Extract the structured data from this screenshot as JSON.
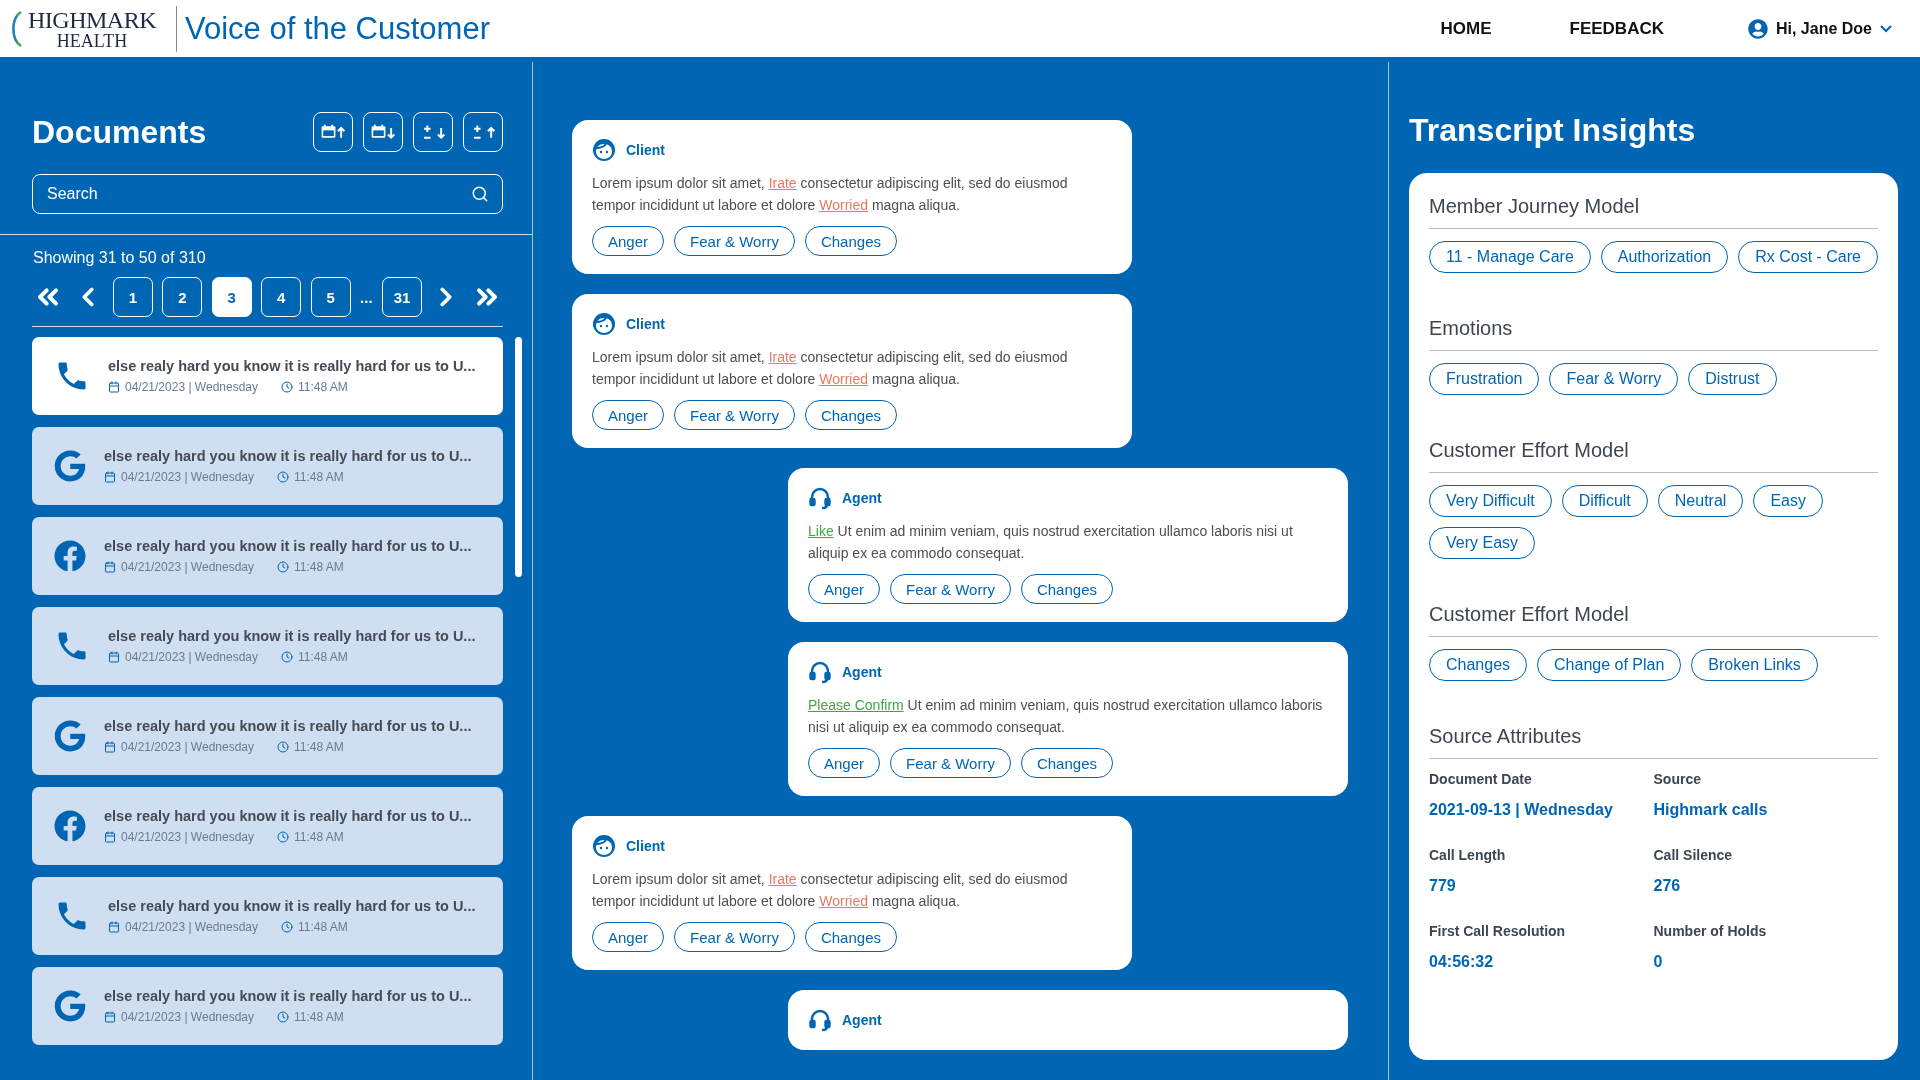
{
  "header": {
    "logo_top": "HIGHMARK",
    "logo_bottom": "HEALTH",
    "title": "Voice of the Customer",
    "nav": [
      {
        "label": "HOME"
      },
      {
        "label": "FEEDBACK"
      }
    ],
    "user": "Hi, Jane Doe"
  },
  "documents": {
    "title": "Documents",
    "sort_buttons": [
      {
        "kind": "date-up"
      },
      {
        "kind": "date-down"
      },
      {
        "kind": "num-down"
      },
      {
        "kind": "num-up"
      }
    ],
    "search": {
      "placeholder": "Search"
    },
    "showing": "Showing 31 to 50 of 310",
    "pages": [
      {
        "label": "1",
        "selected": false
      },
      {
        "label": "2",
        "selected": false
      },
      {
        "label": "3",
        "selected": true
      },
      {
        "label": "4",
        "selected": false
      },
      {
        "label": "5",
        "selected": false
      },
      {
        "label": "...",
        "kind": "gap"
      },
      {
        "label": "31",
        "selected": false
      }
    ],
    "items": [
      {
        "kind": "phone",
        "selected": true,
        "title": "else realy hard you know it is really hard for us to U...",
        "date": "04/21/2023 | Wednesday",
        "time": "11:48 AM"
      },
      {
        "kind": "google",
        "selected": false,
        "title": "else realy hard you know it is really hard for us to U...",
        "date": "04/21/2023 | Wednesday",
        "time": "11:48 AM"
      },
      {
        "kind": "facebook",
        "selected": false,
        "title": "else realy hard you know it is really hard for us to U...",
        "date": "04/21/2023 | Wednesday",
        "time": "11:48 AM"
      },
      {
        "kind": "phone",
        "selected": false,
        "title": "else realy hard you know it is really hard for us to U...",
        "date": "04/21/2023 | Wednesday",
        "time": "11:48 AM"
      },
      {
        "kind": "google",
        "selected": false,
        "title": "else realy hard you know it is really hard for us to U...",
        "date": "04/21/2023 | Wednesday",
        "time": "11:48 AM"
      },
      {
        "kind": "facebook",
        "selected": false,
        "title": "else realy hard you know it is really hard for us to U...",
        "date": "04/21/2023 | Wednesday",
        "time": "11:48 AM"
      },
      {
        "kind": "phone",
        "selected": false,
        "title": "else realy hard you know it is really hard for us to U...",
        "date": "04/21/2023 | Wednesday",
        "time": "11:48 AM"
      },
      {
        "kind": "google",
        "selected": false,
        "title": "else realy hard you know it is really hard for us to U...",
        "date": "04/21/2023 | Wednesday",
        "time": "11:48 AM"
      }
    ]
  },
  "transcript": [
    {
      "kind": "client",
      "speaker": "Client",
      "segments": [
        {
          "kind": "plain",
          "text": "Lorem ipsum dolor sit amet, "
        },
        {
          "kind": "negative",
          "text": "Irate"
        },
        {
          "kind": "plain",
          "text": " consectetur adipiscing elit, sed do eiusmod tempor incididunt ut labore et dolore "
        },
        {
          "kind": "negative",
          "text": "Worried"
        },
        {
          "kind": "plain",
          "text": " magna aliqua."
        }
      ],
      "tags": [
        "Anger",
        "Fear & Worry",
        "Changes"
      ]
    },
    {
      "kind": "client",
      "speaker": "Client",
      "segments": [
        {
          "kind": "plain",
          "text": "Lorem ipsum dolor sit amet, "
        },
        {
          "kind": "negative",
          "text": "Irate"
        },
        {
          "kind": "plain",
          "text": " consectetur adipiscing elit, sed do eiusmod tempor incididunt ut labore et dolore "
        },
        {
          "kind": "negative",
          "text": "Worried"
        },
        {
          "kind": "plain",
          "text": " magna aliqua."
        }
      ],
      "tags": [
        "Anger",
        "Fear & Worry",
        "Changes"
      ]
    },
    {
      "kind": "agent",
      "speaker": "Agent",
      "segments": [
        {
          "kind": "positive",
          "text": "Like"
        },
        {
          "kind": "plain",
          "text": " Ut enim ad minim veniam, quis nostrud exercitation ullamco laboris nisi ut aliquip ex ea commodo consequat."
        }
      ],
      "tags": [
        "Anger",
        "Fear & Worry",
        "Changes"
      ]
    },
    {
      "kind": "agent",
      "speaker": "Agent",
      "segments": [
        {
          "kind": "positive",
          "text": "Please Confirm"
        },
        {
          "kind": "plain",
          "text": " Ut enim ad minim veniam, quis nostrud exercitation ullamco laboris nisi ut aliquip ex ea commodo consequat."
        }
      ],
      "tags": [
        "Anger",
        "Fear & Worry",
        "Changes"
      ]
    },
    {
      "kind": "client",
      "speaker": "Client",
      "segments": [
        {
          "kind": "plain",
          "text": "Lorem ipsum dolor sit amet, "
        },
        {
          "kind": "negative",
          "text": "Irate"
        },
        {
          "kind": "plain",
          "text": " consectetur adipiscing elit, sed do eiusmod tempor incididunt ut labore et dolore "
        },
        {
          "kind": "negative",
          "text": "Worried"
        },
        {
          "kind": "plain",
          "text": " magna aliqua."
        }
      ],
      "tags": [
        "Anger",
        "Fear & Worry",
        "Changes"
      ]
    },
    {
      "kind": "agent",
      "speaker": "Agent"
    }
  ],
  "insights": {
    "title": "Transcript Insights",
    "sections": [
      {
        "kind": "tags",
        "title": "Member Journey Model",
        "tags": [
          "11 - Manage Care",
          "Authorization",
          "Rx Cost - Care"
        ]
      },
      {
        "kind": "tags",
        "title": "Emotions",
        "tags": [
          "Frustration",
          "Fear & Worry",
          "Distrust"
        ]
      },
      {
        "kind": "tags",
        "title": "Customer Effort Model",
        "tags": [
          "Very Difficult",
          "Difficult",
          "Neutral",
          "Easy",
          "Very Easy"
        ]
      },
      {
        "kind": "tags",
        "title": "Customer Effort Model",
        "tags": [
          "Changes",
          "Change of Plan",
          "Broken Links"
        ]
      },
      {
        "kind": "attributes",
        "title": "Source Attributes",
        "fields": [
          {
            "label": "Document Date",
            "value": "2021-09-13 | Wednesday"
          },
          {
            "label": "Source",
            "value": "Highmark calls"
          },
          {
            "label": "Call Length",
            "value": "779"
          },
          {
            "label": "Call Silence",
            "value": "276"
          },
          {
            "label": "First Call Resolution",
            "value": "04:56:32"
          },
          {
            "label": "Number of Holds",
            "value": "0"
          }
        ]
      }
    ]
  }
}
